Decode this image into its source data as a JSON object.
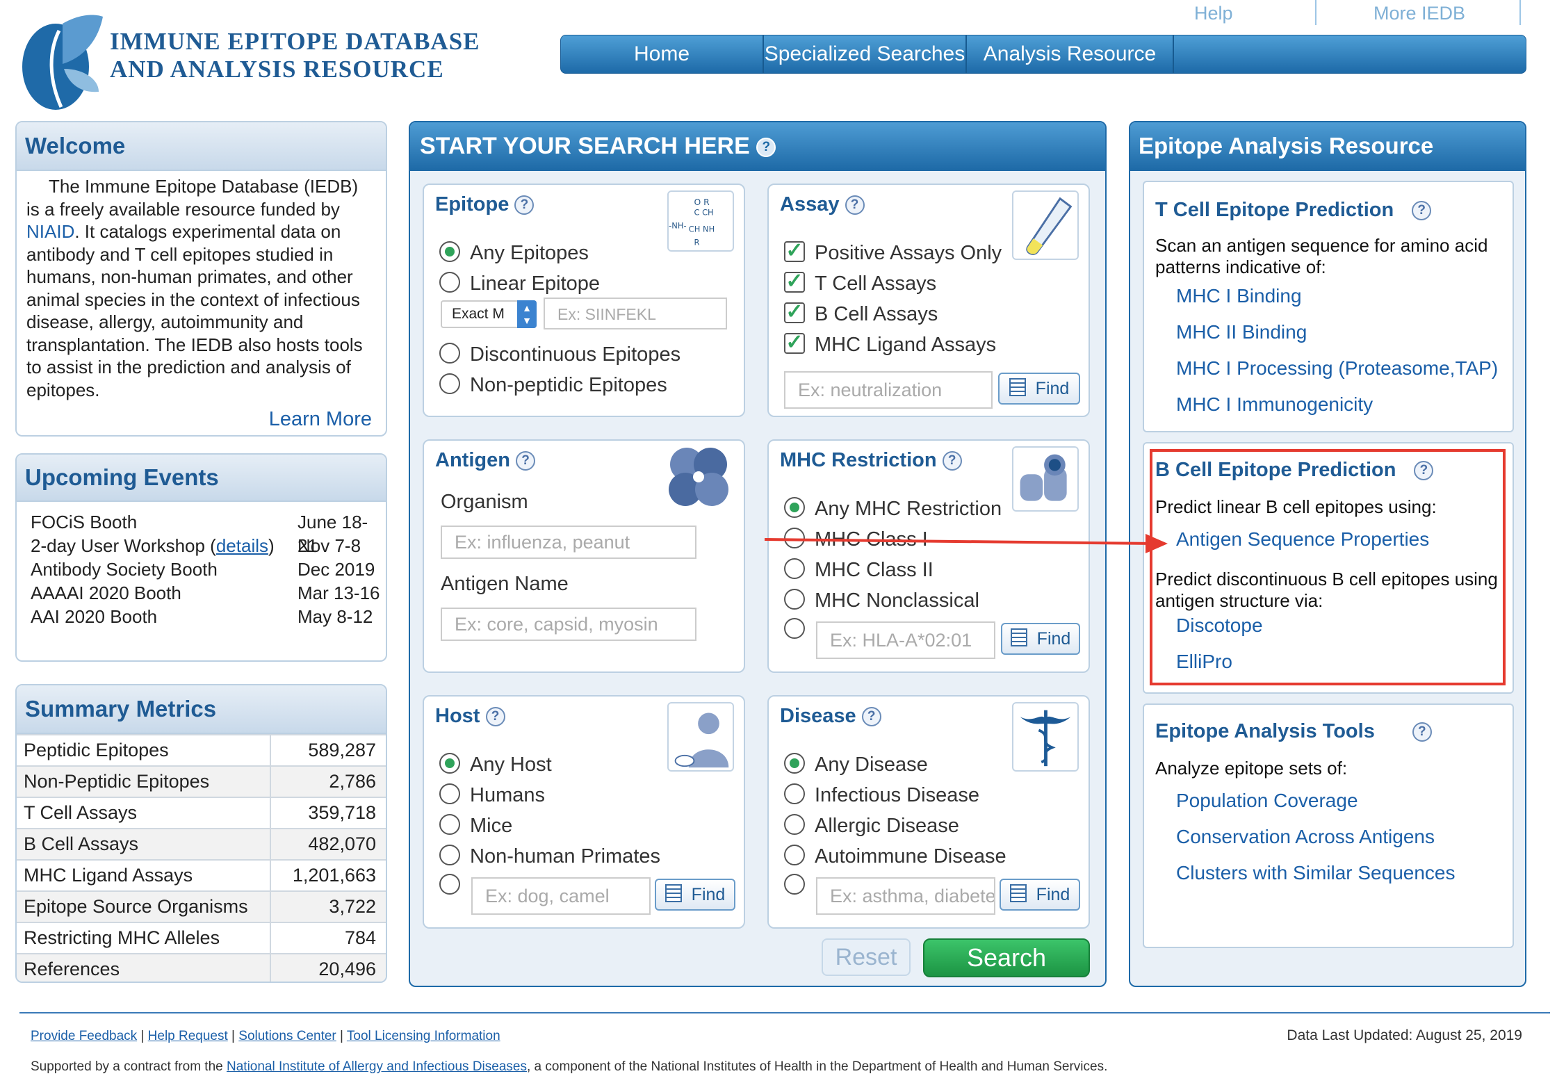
{
  "header": {
    "logo_line1": "IMMUNE EPITOPE DATABASE",
    "logo_line2": "AND ANALYSIS RESOURCE",
    "top_links": [
      "Help",
      "More IEDB"
    ],
    "nav": [
      "Home",
      "Specialized Searches",
      "Analysis Resource"
    ]
  },
  "welcome": {
    "title": "Welcome",
    "text_pre": "The Immune Epitope Database (IEDB) is a freely available resource funded by ",
    "niaid": "NIAID",
    "text_post": ". It catalogs experimental data on antibody and T cell epitopes studied in humans, non-human primates, and other animal species in the context of infectious disease, allergy, autoimmunity and transplantation. The IEDB also hosts tools to assist in the prediction and analysis of epitopes.",
    "learn_more": "Learn More"
  },
  "events": {
    "title": "Upcoming Events",
    "items": [
      {
        "name": "FOCiS Booth",
        "date": "June 18-21"
      },
      {
        "name_pre": "2-day User Workshop (",
        "link": "details",
        "name_post": ")",
        "date": "Nov 7-8"
      },
      {
        "name": "Antibody Society Booth",
        "date": "Dec 2019"
      },
      {
        "name": "AAAAI 2020 Booth",
        "date": "Mar 13-16"
      },
      {
        "name": "AAI 2020 Booth",
        "date": "May 8-12"
      }
    ]
  },
  "metrics": {
    "title": "Summary Metrics",
    "rows": [
      {
        "k": "Peptidic Epitopes",
        "v": "589,287"
      },
      {
        "k": "Non-Peptidic Epitopes",
        "v": "2,786"
      },
      {
        "k": "T Cell Assays",
        "v": "359,718"
      },
      {
        "k": "B Cell Assays",
        "v": "482,070"
      },
      {
        "k": "MHC Ligand Assays",
        "v": "1,201,663"
      },
      {
        "k": "Epitope Source Organisms",
        "v": "3,722"
      },
      {
        "k": "Restricting MHC Alleles",
        "v": "784"
      },
      {
        "k": "References",
        "v": "20,496"
      }
    ]
  },
  "search": {
    "title": "START YOUR SEARCH HERE",
    "epitope": {
      "title": "Epitope",
      "options": [
        "Any Epitopes",
        "Linear Epitope",
        "Discontinuous Epitopes",
        "Non-peptidic Epitopes"
      ],
      "match_select": "Exact M",
      "seq_placeholder": "Ex: SIINFEKL"
    },
    "assay": {
      "title": "Assay",
      "options": [
        "Positive Assays Only",
        "T Cell Assays",
        "B Cell Assays",
        "MHC Ligand Assays"
      ],
      "placeholder": "Ex: neutralization",
      "find": "Find"
    },
    "antigen": {
      "title": "Antigen",
      "organism_label": "Organism",
      "organism_placeholder": "Ex: influenza, peanut",
      "name_label": "Antigen Name",
      "name_placeholder": "Ex: core, capsid, myosin"
    },
    "mhc": {
      "title": "MHC Restriction",
      "options": [
        "Any MHC Restriction",
        "MHC Class I",
        "MHC Class II",
        "MHC Nonclassical"
      ],
      "placeholder": "Ex: HLA-A*02:01",
      "find": "Find"
    },
    "host": {
      "title": "Host",
      "options": [
        "Any Host",
        "Humans",
        "Mice",
        "Non-human Primates"
      ],
      "placeholder": "Ex: dog, camel",
      "find": "Find"
    },
    "disease": {
      "title": "Disease",
      "options": [
        "Any Disease",
        "Infectious Disease",
        "Allergic Disease",
        "Autoimmune Disease"
      ],
      "placeholder": "Ex: asthma, diabetes",
      "find": "Find"
    },
    "reset": "Reset",
    "search": "Search"
  },
  "analysis": {
    "title": "Epitope Analysis Resource",
    "tcell": {
      "title": "T Cell Epitope Prediction",
      "desc": "Scan an antigen sequence for amino acid patterns indicative of:",
      "links": [
        "MHC I Binding",
        "MHC II Binding",
        "MHC I Processing (Proteasome,TAP)",
        "MHC I Immunogenicity"
      ]
    },
    "bcell": {
      "title": "B Cell Epitope Prediction",
      "desc1": "Predict linear B cell epitopes using:",
      "link1": "Antigen Sequence Properties",
      "desc2": "Predict discontinuous B cell epitopes using antigen structure via:",
      "links2": [
        "Discotope",
        "ElliPro"
      ]
    },
    "tools": {
      "title": "Epitope Analysis Tools",
      "desc": "Analyze epitope sets of:",
      "links": [
        "Population Coverage",
        "Conservation Across Antigens",
        "Clusters with Similar Sequences"
      ]
    }
  },
  "footer": {
    "links": [
      "Provide Feedback",
      "Help Request",
      "Solutions Center",
      "Tool Licensing Information"
    ],
    "updated": "Data Last Updated: August 25, 2019",
    "support_pre": "Supported by a contract from the ",
    "support_link": "National Institute of Allergy and Infectious Diseases",
    "support_post": ", a component of the National Institutes of Health in the Department of Health and Human Services."
  },
  "colors": {
    "brand_blue": "#1f5b94",
    "nav_blue": "#1d6aa8",
    "search_green": "#22a04b",
    "highlight_red": "#e53a2f"
  }
}
